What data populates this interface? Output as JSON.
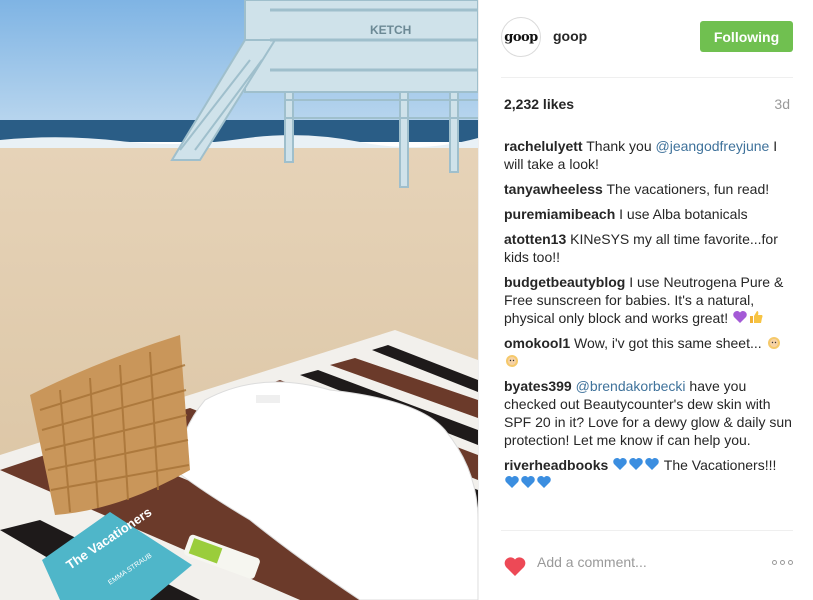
{
  "post": {
    "username": "goop",
    "avatar_text": "goop",
    "follow_label": "Following",
    "likes": "2,232 likes",
    "time_ago": "3d",
    "comment_placeholder": "Add a comment...",
    "photo": {
      "book_title": "The Vacationers",
      "book_author": "EMMA STRAUB",
      "tower_sign": "KETCH"
    },
    "comments": [
      {
        "user": "rachelulyett",
        "mention": "",
        "before": "Thank you ",
        "mention_text": "@jeangodfreyjune",
        "after": " I will take a look!"
      },
      {
        "user": "tanyawheeless",
        "text": "The vacationers, fun read!"
      },
      {
        "user": "puremiamibeach",
        "text": "I use Alba botanicals"
      },
      {
        "user": "atotten13",
        "text": "KINeSYS my all time favorite...for kids too!!"
      },
      {
        "user": "budgetbeautyblog",
        "text": "I use Neutrogena Pure & Free sunscreen for babies. It's a natural, physical only block and works great!"
      },
      {
        "user": "omokool1",
        "text": "Wow, i'v got this same sheet..."
      },
      {
        "user": "byates399",
        "mention_text": "@brendakorbecki",
        "after": " have you checked out Beautycounter's dew skin with SPF 20 in it? Love for a dewy glow & daily sun protection! Let me know if can help you."
      },
      {
        "user": "riverheadbooks",
        "text": "The Vacationers!!!"
      }
    ],
    "colors": {
      "follow_green": "#70c050",
      "mention_blue": "#3f729b",
      "heart_red": "#ed4956"
    }
  }
}
